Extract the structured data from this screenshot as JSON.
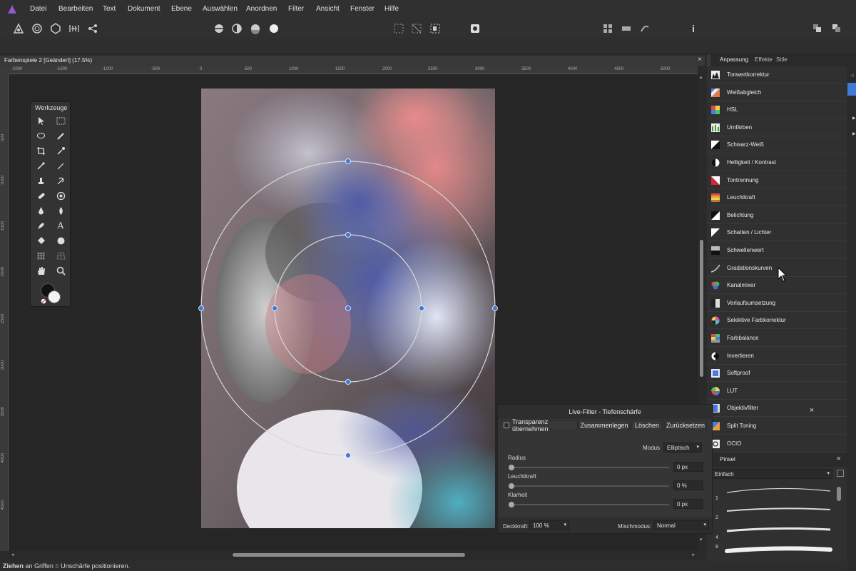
{
  "menu": [
    "Datei",
    "Bearbeiten",
    "Text",
    "Dokument",
    "Ebene",
    "Auswählen",
    "Anordnen",
    "Filter",
    "Ansicht",
    "Fenster",
    "Hilfe"
  ],
  "document": {
    "title": "Farbenspiele 2 [Geändert] (17.5%)",
    "close": "×"
  },
  "ruler_h": [
    "-2000",
    "-1500",
    "-1000",
    "-500",
    "0",
    "500",
    "1000",
    "1500",
    "2000",
    "2500",
    "3000",
    "3500",
    "4000",
    "4500",
    "5000"
  ],
  "ruler_v": [
    "500",
    "1000",
    "1500",
    "2000",
    "2500",
    "3000",
    "3500",
    "4000",
    "4500"
  ],
  "tools_panel": {
    "title": "Werkzeuge",
    "text_tool": "A"
  },
  "right_panel": {
    "tabs": [
      "Anpassung",
      "Effekte",
      "Stile"
    ],
    "adjustments": [
      {
        "label": "Tonwertkorrektur",
        "icon": "levels-icon"
      },
      {
        "label": "Weißabgleich",
        "icon": "white-balance-icon"
      },
      {
        "label": "HSL",
        "icon": "hsl-icon"
      },
      {
        "label": "Umfärben",
        "icon": "recolor-icon"
      },
      {
        "label": "Schwarz-Weiß",
        "icon": "black-white-icon"
      },
      {
        "label": "Helligkeit / Kontrast",
        "icon": "brightness-contrast-icon"
      },
      {
        "label": "Tontrennung",
        "icon": "posterize-icon"
      },
      {
        "label": "Leuchtkraft",
        "icon": "vibrance-icon"
      },
      {
        "label": "Belichtung",
        "icon": "exposure-icon"
      },
      {
        "label": "Schatten / Lichter",
        "icon": "shadows-highlights-icon"
      },
      {
        "label": "Schwellenwert",
        "icon": "threshold-icon"
      },
      {
        "label": "Gradationskurven",
        "icon": "curves-icon"
      },
      {
        "label": "Kanalmixer",
        "icon": "channel-mixer-icon"
      },
      {
        "label": "Verlaufsumsetzung",
        "icon": "gradient-map-icon"
      },
      {
        "label": "Selektive Farbkorrektur",
        "icon": "selective-color-icon"
      },
      {
        "label": "Farbbalance",
        "icon": "color-balance-icon"
      },
      {
        "label": "Invertieren",
        "icon": "invert-icon"
      },
      {
        "label": "Softproof",
        "icon": "soft-proof-icon"
      },
      {
        "label": "LUT",
        "icon": "lut-icon"
      },
      {
        "label": "Objektivfilter",
        "icon": "lens-filter-icon"
      },
      {
        "label": "Split Toning",
        "icon": "split-toning-icon"
      },
      {
        "label": "OCIO",
        "icon": "ocio-icon"
      }
    ]
  },
  "pinsel": {
    "tab": "Pinsel",
    "category": "Einfach",
    "sizes": [
      "1",
      "2",
      "4",
      "8"
    ]
  },
  "live_filter": {
    "title": "Live-Filter - Tiefenschärfe",
    "transparency_label": "Transparenz übernehmen",
    "merge_label": "Zusammenlegen",
    "delete_label": "Löschen",
    "reset_label": "Zurücksetzen",
    "mode_label": "Modus",
    "mode_value": "Elliptisch",
    "radius_label": "Radius",
    "radius_value": "0 px",
    "glow_label": "Leuchtkraft",
    "glow_value": "0 %",
    "clarity_label": "Klarheit",
    "clarity_value": "0 px",
    "opacity_label": "Deckkraft:",
    "opacity_value": "100 %",
    "blend_label": "Mischmodus:",
    "blend_value": "Normal"
  },
  "status": {
    "bold": "Ziehen",
    "rest": " an Griffen = Unschärfe positionieren."
  },
  "colors": {
    "accent": "#3f7ad6",
    "panel": "#303030",
    "canvas": "#262626"
  }
}
